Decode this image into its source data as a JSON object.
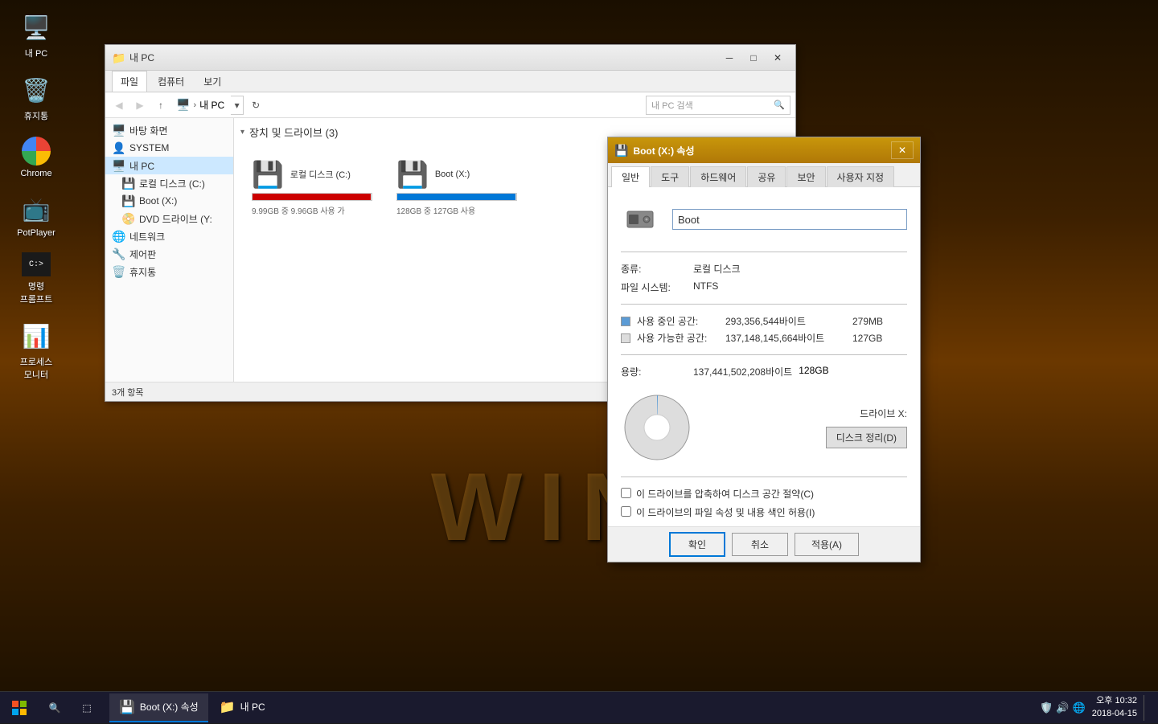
{
  "desktop": {
    "bg_text": "WINDOV"
  },
  "desktop_icons": [
    {
      "id": "my-pc",
      "icon": "🖥️",
      "label": "내 PC"
    },
    {
      "id": "recycle-bin",
      "icon": "🗑️",
      "label": "휴지통"
    },
    {
      "id": "chrome",
      "icon": "🌐",
      "label": "Chrome"
    },
    {
      "id": "potplayer",
      "icon": "▶️",
      "label": "PotPlayer"
    },
    {
      "id": "cmd",
      "icon": "⬛",
      "label": "명령\n프롬프트"
    },
    {
      "id": "process-monitor",
      "icon": "📊",
      "label": "프로세스\n모니터"
    }
  ],
  "explorer": {
    "title": "내 PC",
    "tabs": [
      "파일",
      "컴퓨터",
      "보기"
    ],
    "active_tab": "파일",
    "address": "내 PC",
    "search_placeholder": "내 PC 검색",
    "section_title": "장치 및 드라이브 (3)",
    "status": "3개 항목",
    "sidebar_items": [
      {
        "id": "desktop",
        "icon": "🖥️",
        "label": "바탕 화면"
      },
      {
        "id": "system",
        "icon": "💻",
        "label": "SYSTEM"
      },
      {
        "id": "my-pc",
        "icon": "🖥️",
        "label": "내 PC",
        "selected": true
      },
      {
        "id": "local-c",
        "icon": "💾",
        "label": "로컬 디스크 (C:)"
      },
      {
        "id": "boot-x",
        "icon": "💾",
        "label": "Boot (X:)"
      },
      {
        "id": "dvd-y",
        "icon": "📀",
        "label": "DVD 드라이브 (Y:"
      },
      {
        "id": "network",
        "icon": "🌐",
        "label": "네트워크"
      },
      {
        "id": "control",
        "icon": "🖥️",
        "label": "제어판"
      },
      {
        "id": "recycle",
        "icon": "🗑️",
        "label": "휴지통"
      }
    ],
    "drives": [
      {
        "id": "c",
        "name": "로컬 디스크 (C:)",
        "used_text": "9.99GB 중 9.96GB 사용 가",
        "used_pct": 99,
        "color": "#cc0000"
      },
      {
        "id": "x",
        "name": "Boot (X:)",
        "used_text": "128GB 중 127GB 사용",
        "used_pct": 99,
        "color": "#0078d7"
      }
    ]
  },
  "dialog": {
    "title": "Boot (X:) 속성",
    "tabs": [
      "일반",
      "도구",
      "하드웨어",
      "공유",
      "보안",
      "사용자 지정"
    ],
    "active_tab": "일반",
    "drive_name": "Boot",
    "type_label": "종류:",
    "type_value": "로컬 디스크",
    "fs_label": "파일 시스템:",
    "fs_value": "NTFS",
    "used_label": "사용 중인 공간:",
    "used_bytes": "293,356,544바이트",
    "used_mb": "279MB",
    "free_label": "사용 가능한 공간:",
    "free_bytes": "137,148,145,664바이트",
    "free_mb": "127GB",
    "total_label": "용량:",
    "total_bytes": "137,441,502,208바이트",
    "total_mb": "128GB",
    "drive_letter": "드라이브 X:",
    "cleanup_btn": "디스크 정리(D)",
    "compress_label": "이 드라이브를 압축하여 디스크 공간 절약(C)",
    "index_label": "이 드라이브의 파일 속성 및 내용 색인 허용(I)",
    "ok_btn": "확인",
    "cancel_btn": "취소",
    "apply_btn": "적용(A)"
  },
  "taskbar": {
    "items": [
      {
        "id": "boot-props",
        "icon": "💾",
        "label": "Boot (X:) 속성",
        "active": true
      },
      {
        "id": "my-pc-exp",
        "icon": "📁",
        "label": "내 PC",
        "active": false
      }
    ],
    "clock": {
      "time": "오후 10:32",
      "date": "2018-04-15"
    }
  }
}
